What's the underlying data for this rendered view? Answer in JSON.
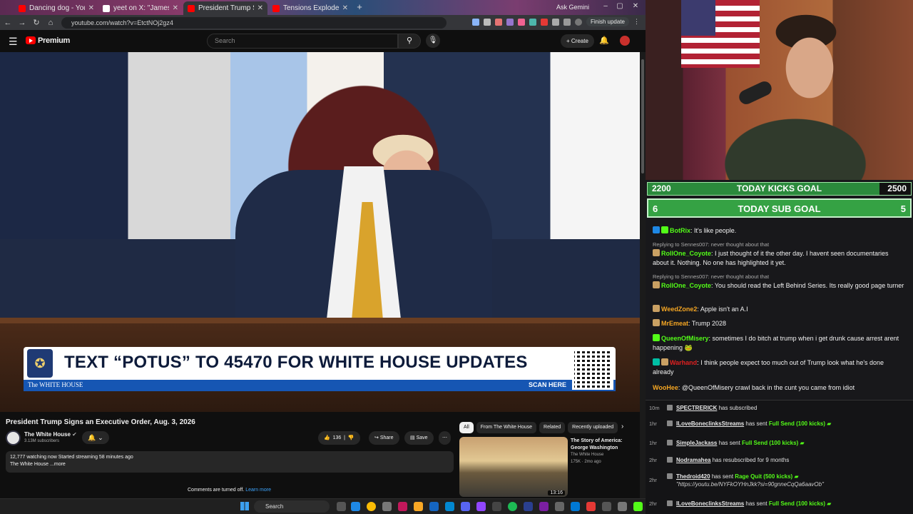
{
  "browser": {
    "tabs": [
      {
        "title": "Dancing dog - YouTube",
        "color": "#ff0000"
      },
      {
        "title": "yeet on X: \"James Carville ann",
        "color": "#ffffff"
      },
      {
        "title": "President Trump Signs an E",
        "color": "#ff0000",
        "active": true
      },
      {
        "title": "Tensions Explode as Locals Cla",
        "color": "#ff0000"
      }
    ],
    "ask_gemini": "Ask Gemini",
    "url": "youtube.com/watch?v=EtctNOj2gz4",
    "finish_update": "Finish update"
  },
  "youtube": {
    "brand": "Premium",
    "search_placeholder": "Search",
    "create_label": "Create",
    "video": {
      "banner_text": "TEXT “POTUS” TO 45470 FOR WHITE HOUSE UPDATES",
      "banner_org": "The WHITE HOUSE",
      "banner_cta": "SCAN HERE"
    },
    "title": "President Trump Signs an Executive Order, Aug. 3, 2026",
    "channel": {
      "name": "The White House",
      "subs": "3.13M subscribers"
    },
    "likes": "136",
    "share_label": "Share",
    "save_label": "Save",
    "desc_line1": "12,777 watching now  Started streaming 58 minutes ago",
    "desc_line2": "The White House ...more",
    "comments_off": "Comments are turned off.",
    "learn_more": "Learn more",
    "chips": [
      "All",
      "From The White House",
      "Related",
      "Recently uploaded"
    ],
    "related": {
      "title": "The Story of America: George Washington",
      "channel": "The White House",
      "meta": "175K · 2mo ago",
      "duration": "13:16"
    }
  },
  "stream": {
    "kicks_goal": {
      "current": "2200",
      "label": "TODAY KICKS GOAL",
      "target": "2500"
    },
    "sub_goal": {
      "current": "6",
      "label": "TODAY SUB GOAL",
      "target": "5"
    },
    "chat": [
      {
        "user": "BotRix",
        "color": "#53fc18",
        "text": "It's like people."
      },
      {
        "reply": "Replying to Sennes007: never thought about that",
        "user": "RollOne_Coyote",
        "color": "#53fc18",
        "text": "I just thought of it the other day. I havent seen documentaries about it. Nothing. No one has highlighted it yet."
      },
      {
        "reply": "Replying to Sennes007: never thought about that",
        "user": "RollOne_Coyote",
        "color": "#53fc18",
        "text": "You should read the Left Behind Series. Its really good page turner"
      },
      {
        "user": "WeedZone2",
        "color": "#f5a623",
        "text": "Apple isn't an A.I"
      },
      {
        "user": "MrEmeat",
        "color": "#f5a623",
        "text": "Trump 2028"
      },
      {
        "user": "QueenOfMisery",
        "color": "#53fc18",
        "text": "sometimes I do bitch at trump when i get drunk cause arrest arent happening"
      },
      {
        "user": "Warhand",
        "color": "#e02020",
        "text": "I think people expect too much out of Trump look what he's done already"
      },
      {
        "user": "WooHee",
        "color": "#f5a623",
        "text": "@QueenOfMisery crawl back in the cunt you came from idiot"
      }
    ],
    "events": [
      {
        "time": "10m",
        "name": "SPECTRERICK",
        "text": "has subscribed"
      },
      {
        "time": "1hr",
        "name": "ILoveBoneclinksStreams",
        "text": "has sent",
        "gift": "Full Send (100 kicks)"
      },
      {
        "time": "1hr",
        "name": "SimpleJackass",
        "text": "has sent",
        "gift": "Full Send (100 kicks)"
      },
      {
        "time": "2hr",
        "name": "Nodramahea",
        "text": "has resubscribed for 9 months"
      },
      {
        "time": "2hr",
        "name": "Thedroid420",
        "text": "has sent",
        "gift": "Rage Quit (500 kicks)",
        "link": "\"https://youtu.be/NYFkOYHnJkk?si=90gnneCqQa6aavOb\""
      },
      {
        "time": "2hr",
        "name": "ILoveBoneclinksStreams",
        "text": "has sent",
        "gift": "Full Send (100 kicks)"
      }
    ]
  },
  "taskbar": {
    "search": "Search"
  }
}
